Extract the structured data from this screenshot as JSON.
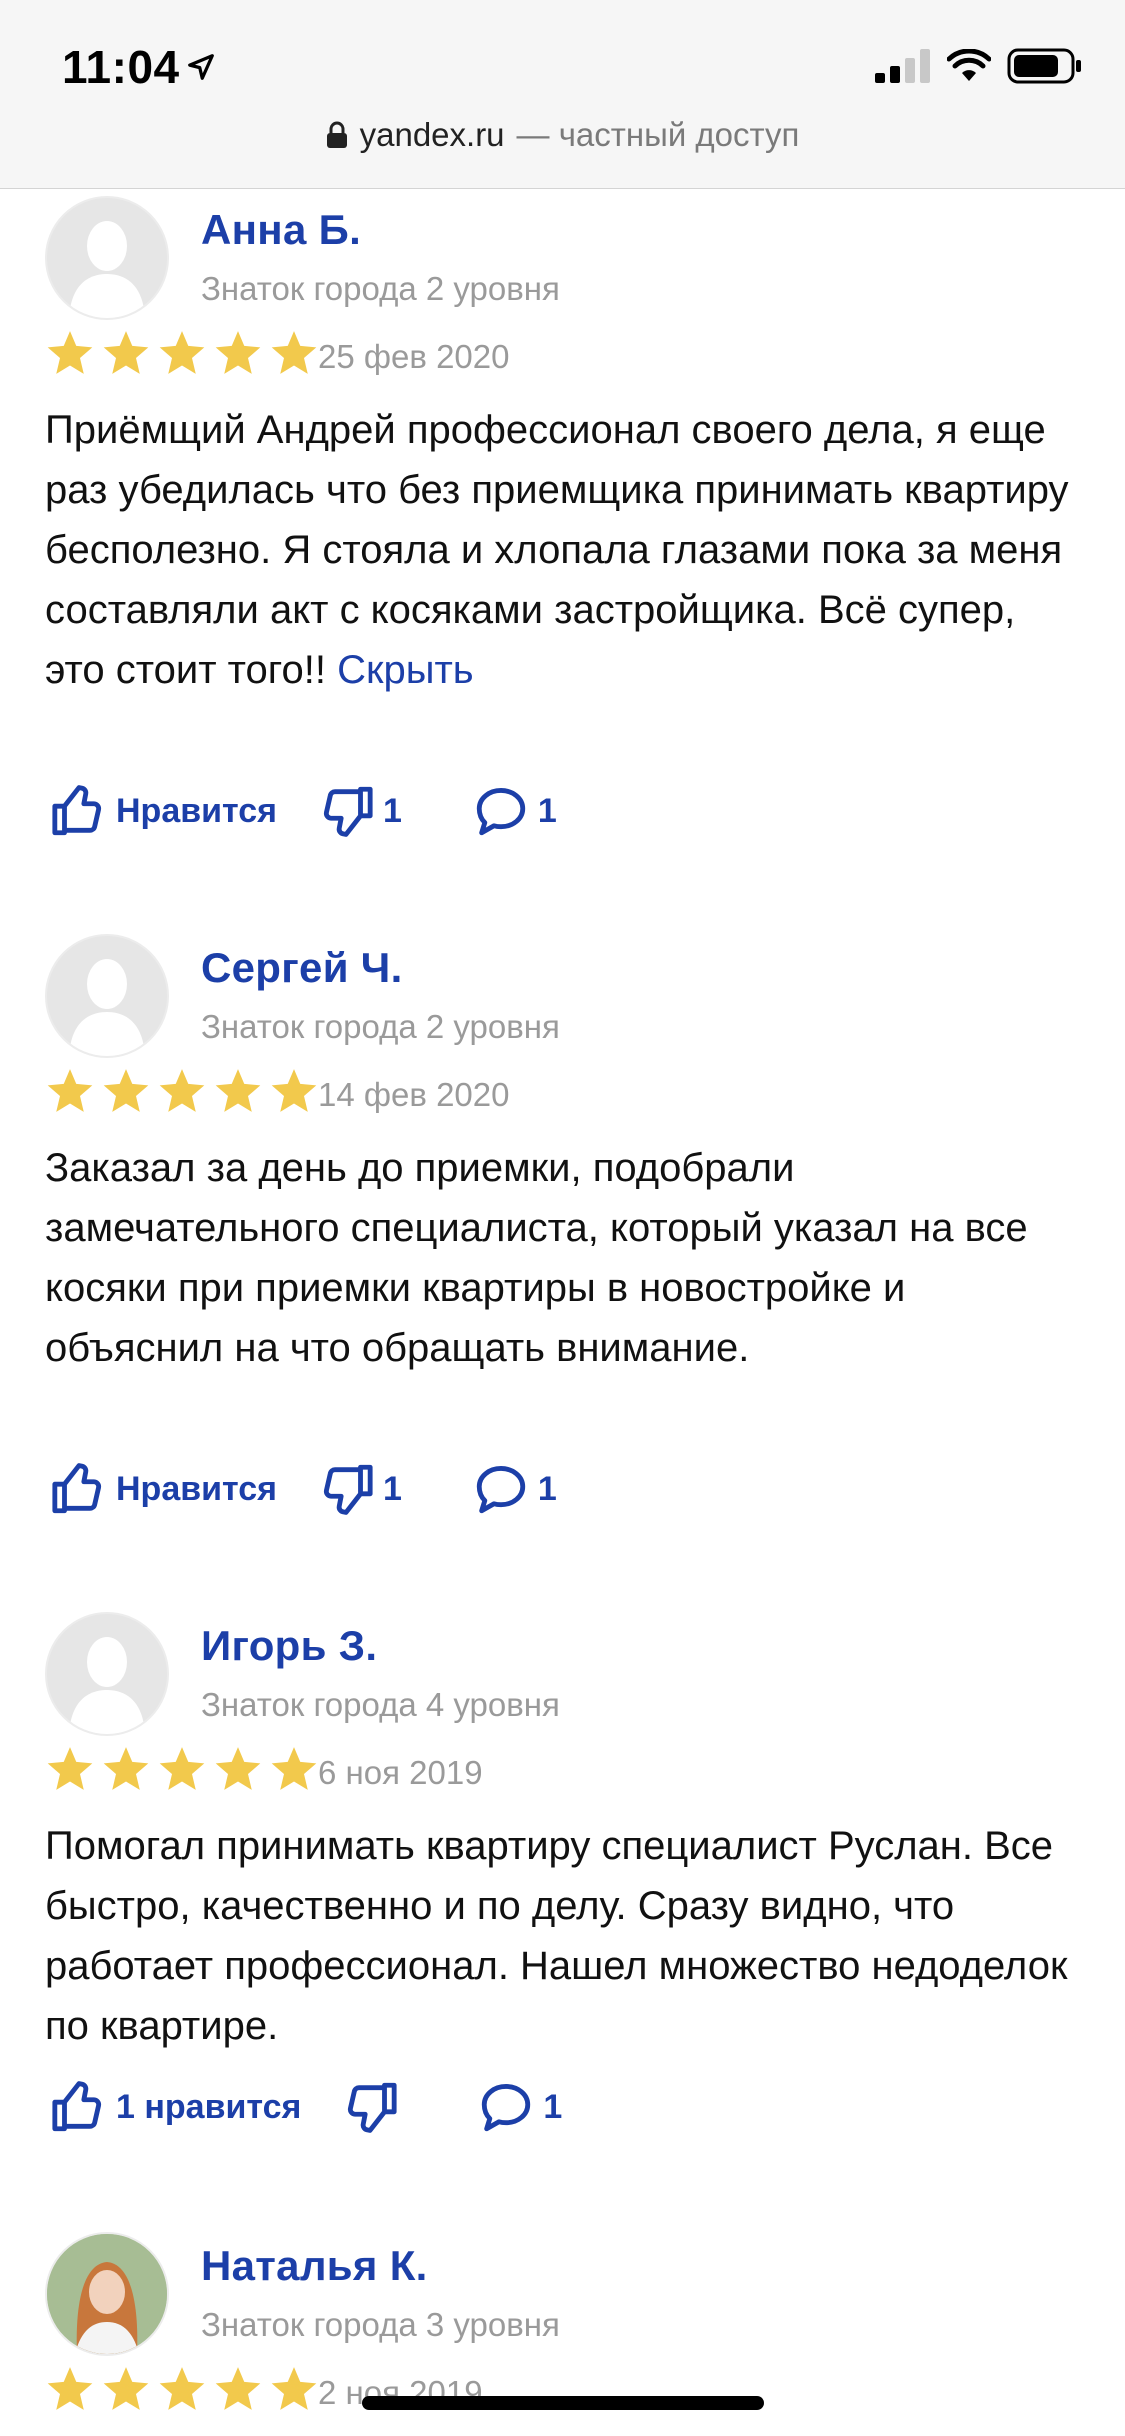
{
  "status_bar": {
    "time": "11:04"
  },
  "url_bar": {
    "domain": "yandex.ru",
    "suffix": "— частный доступ"
  },
  "reviews": [
    {
      "name": "Анна Б.",
      "level": "Знаток города 2 уровня",
      "rating": 5,
      "date": "25 фев 2020",
      "text": "Приёмщий Андрей профессионал своего дела, я еще раз убедилась что без приемщика принимать квартиру бесполезно. Я стояла и хлопала глазами пока за меня составляли акт с косяками застройщика. Всё супер, это стоит того!!",
      "hide_label": "Скрыть",
      "like_label": "Нравится",
      "dislike_count": "1",
      "comment_count": "1"
    },
    {
      "name": "Сергей Ч.",
      "level": "Знаток города 2 уровня",
      "rating": 5,
      "date": "14 фев 2020",
      "text": "Заказал за день до приемки, подобрали замечательного специалиста, который указал на все косяки при приемки квартиры в новостройке и объяснил на что обращать внимание.",
      "like_label": "Нравится",
      "dislike_count": "1",
      "comment_count": "1"
    },
    {
      "name": "Игорь З.",
      "level": "Знаток города 4 уровня",
      "rating": 5,
      "date": "6 ноя 2019",
      "text": "Помогал принимать квартиру специалист Руслан. Все быстро, качественно и по делу. Сразу видно, что работает профессионал. Нашел множество недоделок по квартире.",
      "like_label": "1 нравится",
      "dislike_count": "",
      "comment_count": "1"
    },
    {
      "name": "Наталья К.",
      "level": "Знаток города 3 уровня",
      "rating": 5,
      "date": "2 ноя 2019"
    }
  ],
  "colors": {
    "accent": "#1c3fa8",
    "star": "#f2c94c",
    "muted": "#9a9a9a"
  }
}
